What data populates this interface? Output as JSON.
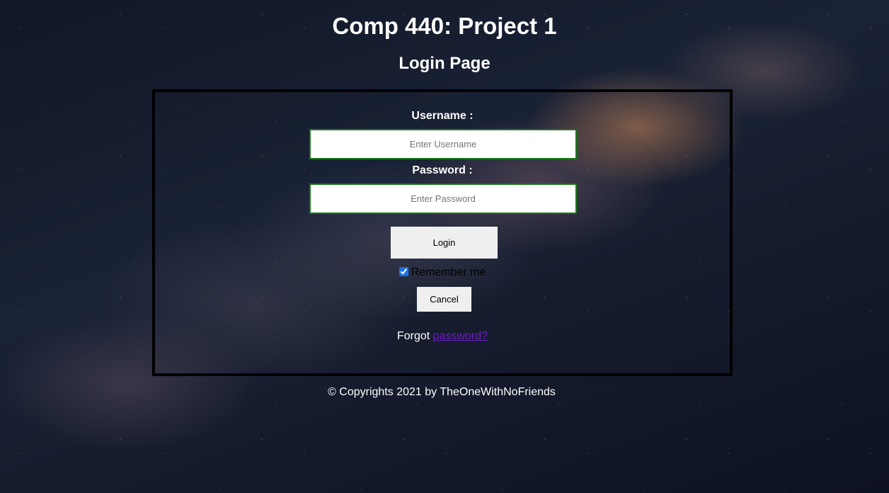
{
  "header": {
    "title": "Comp 440: Project 1",
    "subtitle": "Login Page"
  },
  "form": {
    "username_label": "Username :",
    "username_placeholder": "Enter Username",
    "username_value": "",
    "password_label": "Password :",
    "password_placeholder": "Enter Password",
    "password_value": "",
    "login_label": "Login",
    "remember_label": "Remember me",
    "remember_checked": true,
    "cancel_label": "Cancel",
    "forgot_prefix": "Forgot",
    "forgot_link": "password?"
  },
  "footer": {
    "text": "© Copyrights 2021 by TheOneWithNoFriends"
  },
  "colors": {
    "input_border": "#1a7a1a",
    "link": "#6a1fbf",
    "box_border": "#000000",
    "checkbox_accent": "#1a73e8"
  }
}
